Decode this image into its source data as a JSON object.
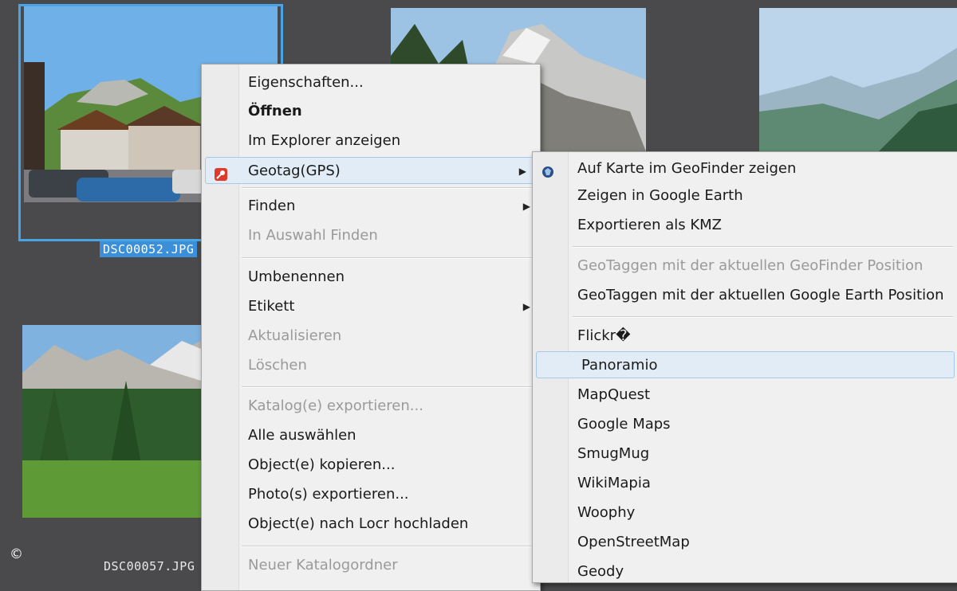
{
  "thumbnails": [
    {
      "caption": "DSC00052.JPG"
    },
    {
      "caption": ""
    },
    {
      "caption": ""
    },
    {
      "caption": "DSC00057.JPG"
    }
  ],
  "copyright": "©",
  "context_menu": {
    "items": [
      {
        "label": "Eigenschaften..."
      },
      {
        "label": "Öffnen"
      },
      {
        "label": "Im Explorer anzeigen"
      },
      {
        "label": "Geotag(GPS)",
        "icon": "geotag-icon"
      },
      {
        "label": "Finden"
      },
      {
        "label": "In Auswahl Finden"
      },
      {
        "label": "Umbenennen"
      },
      {
        "label": "Etikett"
      },
      {
        "label": "Aktualisieren"
      },
      {
        "label": "Löschen"
      },
      {
        "label": "Katalog(e) exportieren..."
      },
      {
        "label": "Alle auswählen"
      },
      {
        "label": "Object(e) kopieren..."
      },
      {
        "label": "Photo(s) exportieren..."
      },
      {
        "label": "Object(e) nach Locr hochladen"
      },
      {
        "label": "Neuer Katalogordner"
      }
    ]
  },
  "geotag_submenu": {
    "items": [
      {
        "label": "Auf Karte im GeoFinder zeigen",
        "icon": "geofinder-icon"
      },
      {
        "label": "Zeigen in Google Earth"
      },
      {
        "label": "Exportieren als KMZ"
      },
      {
        "label": "GeoTaggen mit der aktuellen GeoFinder Position"
      },
      {
        "label": "GeoTaggen mit der aktuellen Google Earth Position"
      },
      {
        "label": "Flickr�"
      },
      {
        "label": "Panoramio"
      },
      {
        "label": "MapQuest"
      },
      {
        "label": "Google Maps"
      },
      {
        "label": "SmugMug"
      },
      {
        "label": "WikiMapia"
      },
      {
        "label": "Woophy"
      },
      {
        "label": "OpenStreetMap"
      },
      {
        "label": "Geody"
      }
    ]
  },
  "colors": {
    "background": "#4a4a4c",
    "selection": "#49a4e6",
    "menu": "#f0f0f0",
    "highlight": "#e2ecf7",
    "disabled_text": "#9a9a9a"
  }
}
